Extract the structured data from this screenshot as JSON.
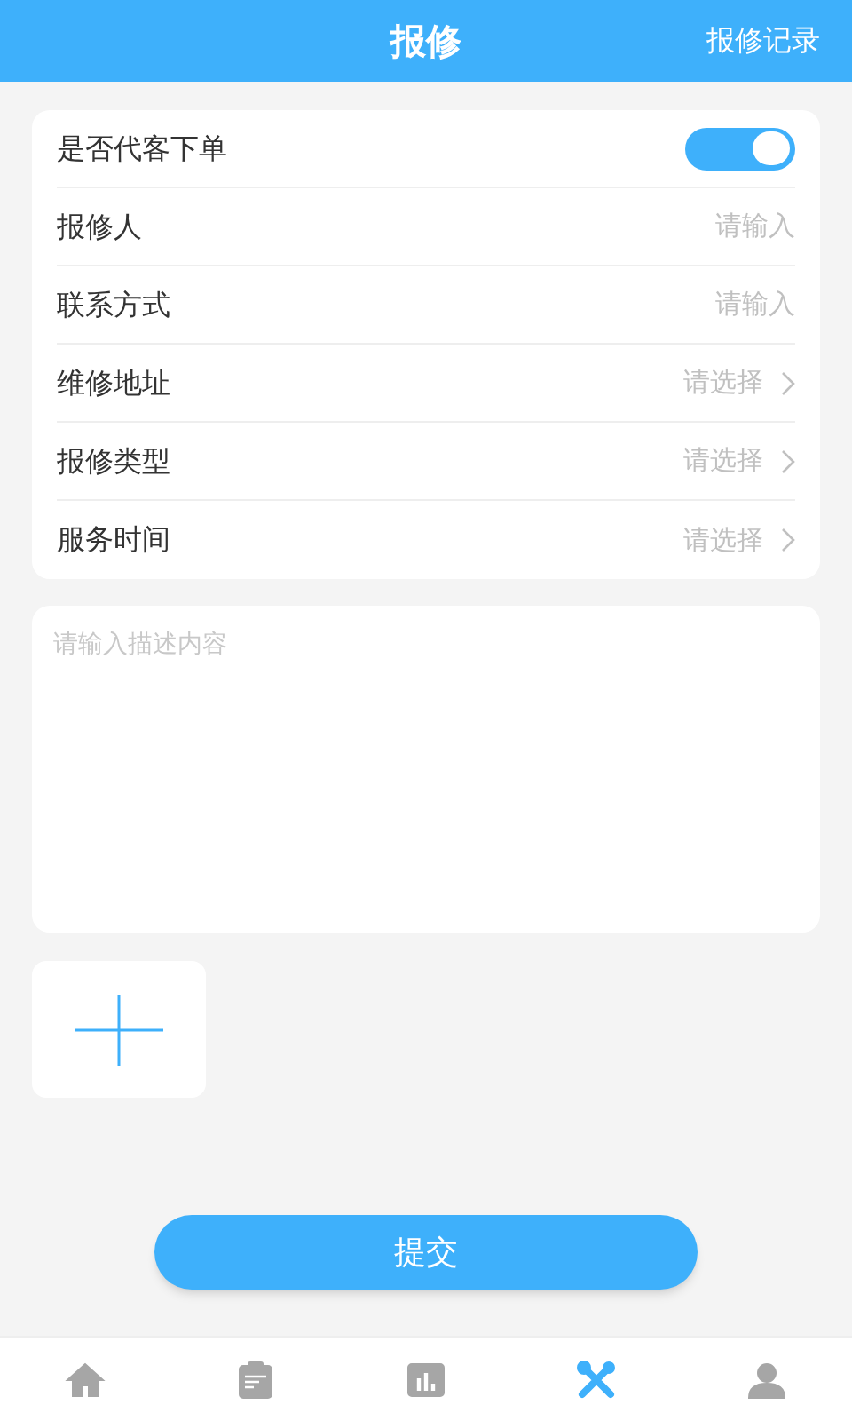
{
  "header": {
    "title": "报修",
    "action": "报修记录"
  },
  "form_rows": [
    {
      "kind": "switch",
      "label": "是否代客下单",
      "on": true
    },
    {
      "kind": "input",
      "label": "报修人",
      "placeholder": "请输入"
    },
    {
      "kind": "input",
      "label": "联系方式",
      "placeholder": "请输入"
    },
    {
      "kind": "select",
      "label": "维修地址",
      "placeholder": "请选择"
    },
    {
      "kind": "select",
      "label": "报修类型",
      "placeholder": "请选择"
    },
    {
      "kind": "select",
      "label": "服务时间",
      "placeholder": "请选择"
    }
  ],
  "description": {
    "placeholder": "请输入描述内容"
  },
  "submit_button": "提交",
  "tab_bar": [
    {
      "selected": false
    },
    {
      "selected": false
    },
    {
      "selected": false
    },
    {
      "selected": true
    },
    {
      "selected": false
    }
  ]
}
